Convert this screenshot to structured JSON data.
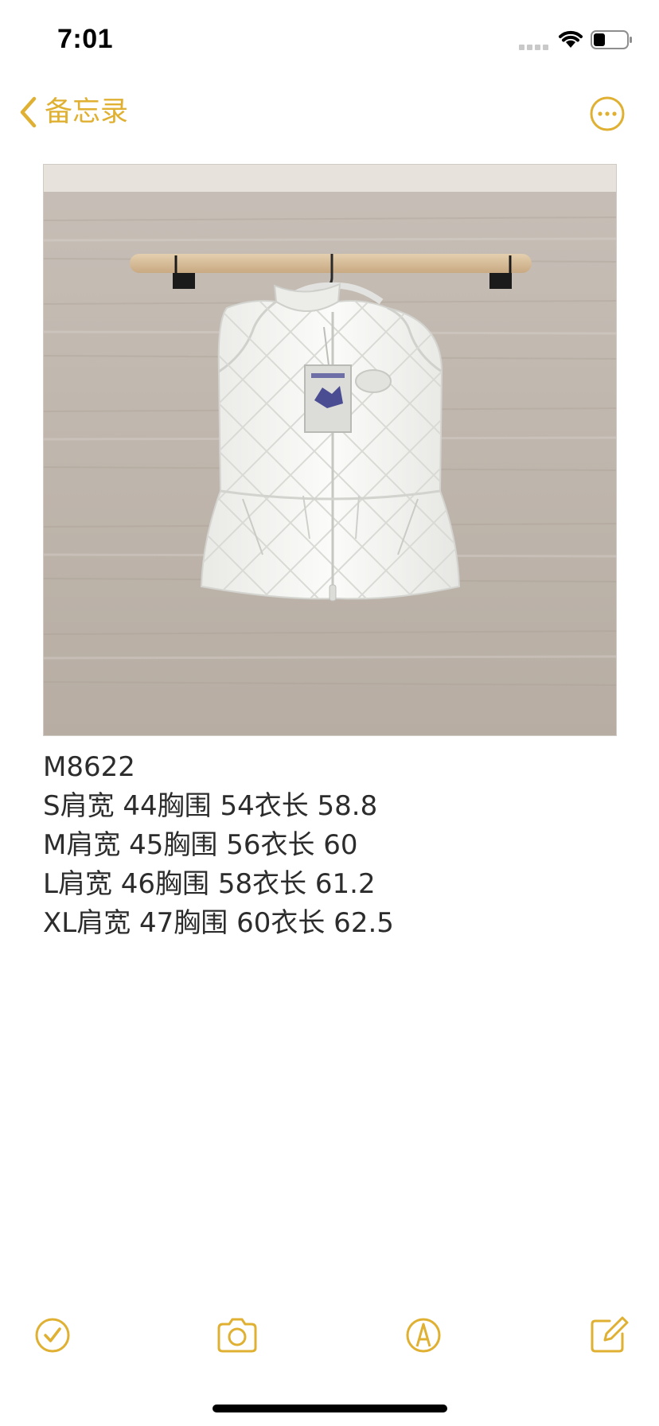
{
  "status_bar": {
    "time": "7:01",
    "icons": [
      "cellular-signal-icon",
      "wifi-icon",
      "battery-icon"
    ]
  },
  "nav": {
    "back_label": "备忘录",
    "back_icon": "chevron-left-icon",
    "more_icon": "ellipsis-circle-icon"
  },
  "theme": {
    "accent": "#dfb032",
    "text": "#2c2c2c"
  },
  "note": {
    "photo": "white-quilted-vest-photo",
    "lines": [
      "M8622",
      "S肩宽 44胸围 54衣长 58.8",
      "M肩宽 45胸围 56衣长 60",
      "L肩宽 46胸围 58衣长 61.2",
      "XL肩宽 47胸围 60衣长 62.5"
    ]
  },
  "toolbar": {
    "items": [
      "checklist-icon",
      "camera-icon",
      "markup-pen-icon",
      "compose-icon"
    ]
  }
}
